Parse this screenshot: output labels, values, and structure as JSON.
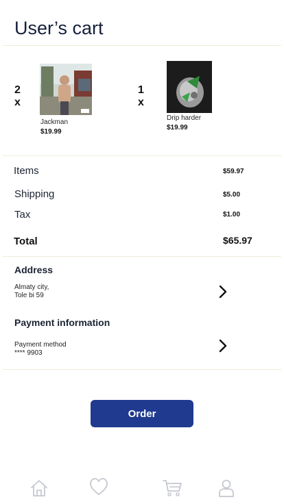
{
  "header": {
    "title": "User’s cart"
  },
  "items": [
    {
      "qty": "2 x",
      "name": "Jackman",
      "price": "$19.99",
      "image": "album-cover-jackman"
    },
    {
      "qty": "1 x",
      "name": "Drip harder",
      "price": "$19.99",
      "image": "album-cover-drip-harder"
    }
  ],
  "summary": {
    "items_label": "Items",
    "items_value": "$59.97",
    "shipping_label": "Shipping",
    "shipping_value": "$5.00",
    "tax_label": "Tax",
    "tax_value": "$1.00",
    "total_label": "Total",
    "total_value": "$65.97"
  },
  "address": {
    "title": "Address",
    "line1": "Almaty city,",
    "line2": "Tole bi 59"
  },
  "payment": {
    "title": "Payment information",
    "line1": "Payment method",
    "line2": "**** 9903"
  },
  "order_button": {
    "label": "Order"
  },
  "nav": [
    {
      "icon": "home-icon"
    },
    {
      "icon": "heart-icon"
    },
    {
      "icon": "cart-icon"
    },
    {
      "icon": "user-icon"
    }
  ],
  "colors": {
    "accent": "#1f3a8f",
    "divider": "#f1ecd9",
    "nav_icon": "#c4c8d0"
  }
}
